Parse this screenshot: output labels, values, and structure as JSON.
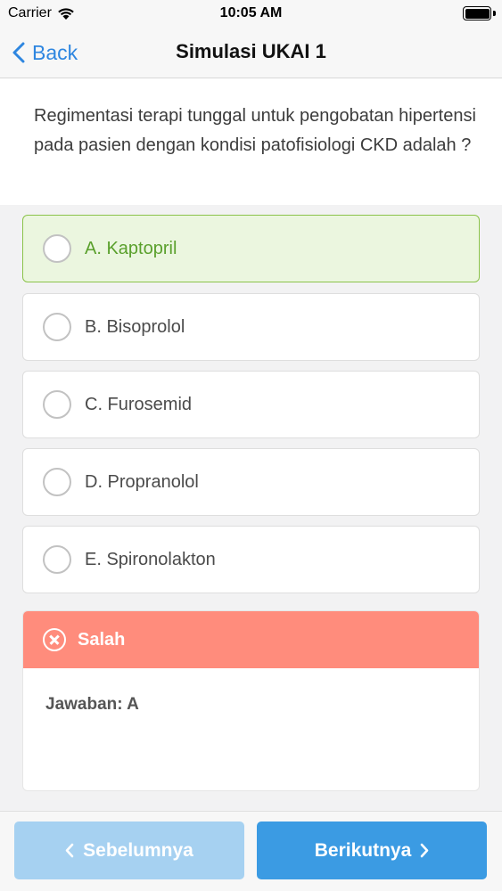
{
  "status_bar": {
    "carrier": "Carrier",
    "time": "10:05 AM"
  },
  "nav": {
    "back_label": "Back",
    "title": "Simulasi UKAI 1"
  },
  "question": {
    "text": "Regimentasi terapi tunggal untuk pengobatan hipertensi pada pasien dengan kondisi patofisiologi CKD adalah ?"
  },
  "options": [
    {
      "label": "A. Kaptopril",
      "selected": true
    },
    {
      "label": "B. Bisoprolol",
      "selected": false
    },
    {
      "label": "C. Furosemid",
      "selected": false
    },
    {
      "label": "D. Propranolol",
      "selected": false
    },
    {
      "label": "E. Spironolakton",
      "selected": false
    }
  ],
  "result": {
    "status": "Salah",
    "answer": "Jawaban: A",
    "icon": "close-circle-icon"
  },
  "footer": {
    "prev_label": "Sebelumnya",
    "next_label": "Berikutnya"
  },
  "colors": {
    "accent": "#2e86e0",
    "selected_bg": "#ebf6df",
    "selected_border": "#8bc34a",
    "wrong": "#ff8c7c",
    "next_button": "#3b9be3",
    "prev_button": "#a6d1f1"
  }
}
